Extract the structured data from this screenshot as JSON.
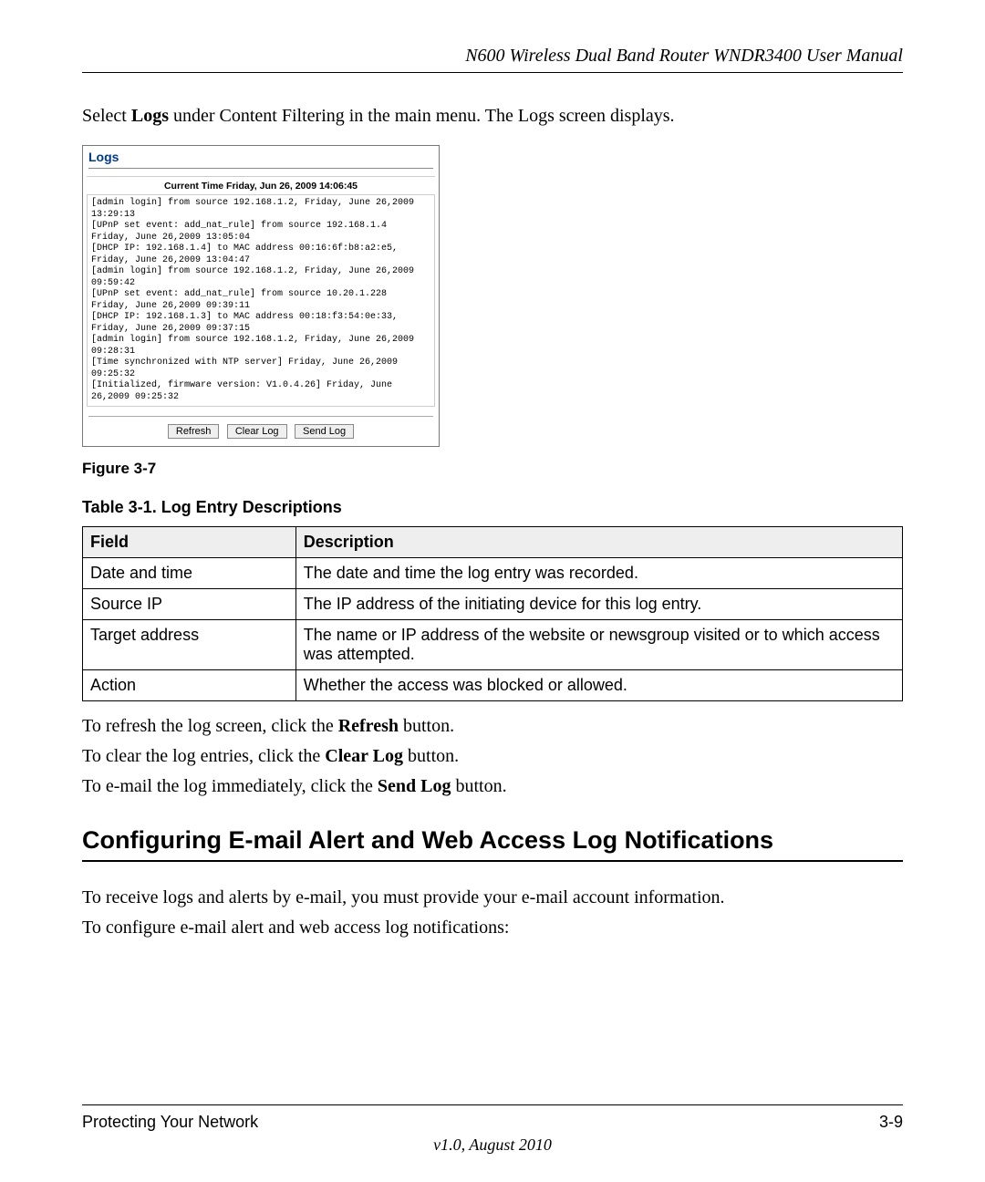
{
  "header": {
    "title": "N600 Wireless Dual Band Router WNDR3400 User Manual"
  },
  "intro": {
    "prefix": "Select ",
    "bold": "Logs",
    "suffix": " under Content Filtering in the main menu. The Logs screen displays."
  },
  "logs_panel": {
    "title": "Logs",
    "current_time_label": "Current Time Friday, Jun 26, 2009 14:06:45",
    "log_text": "[admin login] from source 192.168.1.2, Friday, June 26,2009 13:29:13\n[UPnP set event: add_nat_rule] from source 192.168.1.4 Friday, June 26,2009 13:05:04\n[DHCP IP: 192.168.1.4] to MAC address 00:16:6f:b8:a2:e5, Friday, June 26,2009 13:04:47\n[admin login] from source 192.168.1.2, Friday, June 26,2009 09:59:42\n[UPnP set event: add_nat_rule] from source 10.20.1.228 Friday, June 26,2009 09:39:11\n[DHCP IP: 192.168.1.3] to MAC address 00:18:f3:54:0e:33, Friday, June 26,2009 09:37:15\n[admin login] from source 192.168.1.2, Friday, June 26,2009 09:28:31\n[Time synchronized with NTP server] Friday, June 26,2009 09:25:32\n[Initialized, firmware version: V1.0.4.26] Friday, June 26,2009 09:25:32",
    "buttons": {
      "refresh": "Refresh",
      "clear_log": "Clear Log",
      "send_log": "Send Log"
    }
  },
  "figure_caption": "Figure 3-7",
  "table_caption": "Table 3-1.  Log Entry Descriptions",
  "table": {
    "headers": {
      "field": "Field",
      "description": "Description"
    },
    "rows": [
      {
        "field": "Date and time",
        "description": "The date and time the log entry was recorded."
      },
      {
        "field": "Source IP",
        "description": "The IP address of the initiating device for this log entry."
      },
      {
        "field": "Target address",
        "description": "The name or IP address of the website or newsgroup visited or to which access was attempted."
      },
      {
        "field": "Action",
        "description": "Whether the access was blocked or allowed."
      }
    ]
  },
  "paragraphs": {
    "p1_prefix": "To refresh the log screen, click the ",
    "p1_bold": "Refresh",
    "p1_suffix": " button.",
    "p2_prefix": "To clear the log entries, click the ",
    "p2_bold": "Clear Log",
    "p2_suffix": " button.",
    "p3_prefix": "To e-mail the log immediately, click the ",
    "p3_bold": "Send Log",
    "p3_suffix": " button."
  },
  "section_heading": "Configuring E-mail Alert and Web Access Log Notifications",
  "after_heading": {
    "p1": "To receive logs and alerts by e-mail, you must provide your e-mail account information.",
    "p2": "To configure e-mail alert and web access log notifications:"
  },
  "footer": {
    "left": "Protecting Your Network",
    "right": "3-9",
    "center": "v1.0, August 2010"
  }
}
